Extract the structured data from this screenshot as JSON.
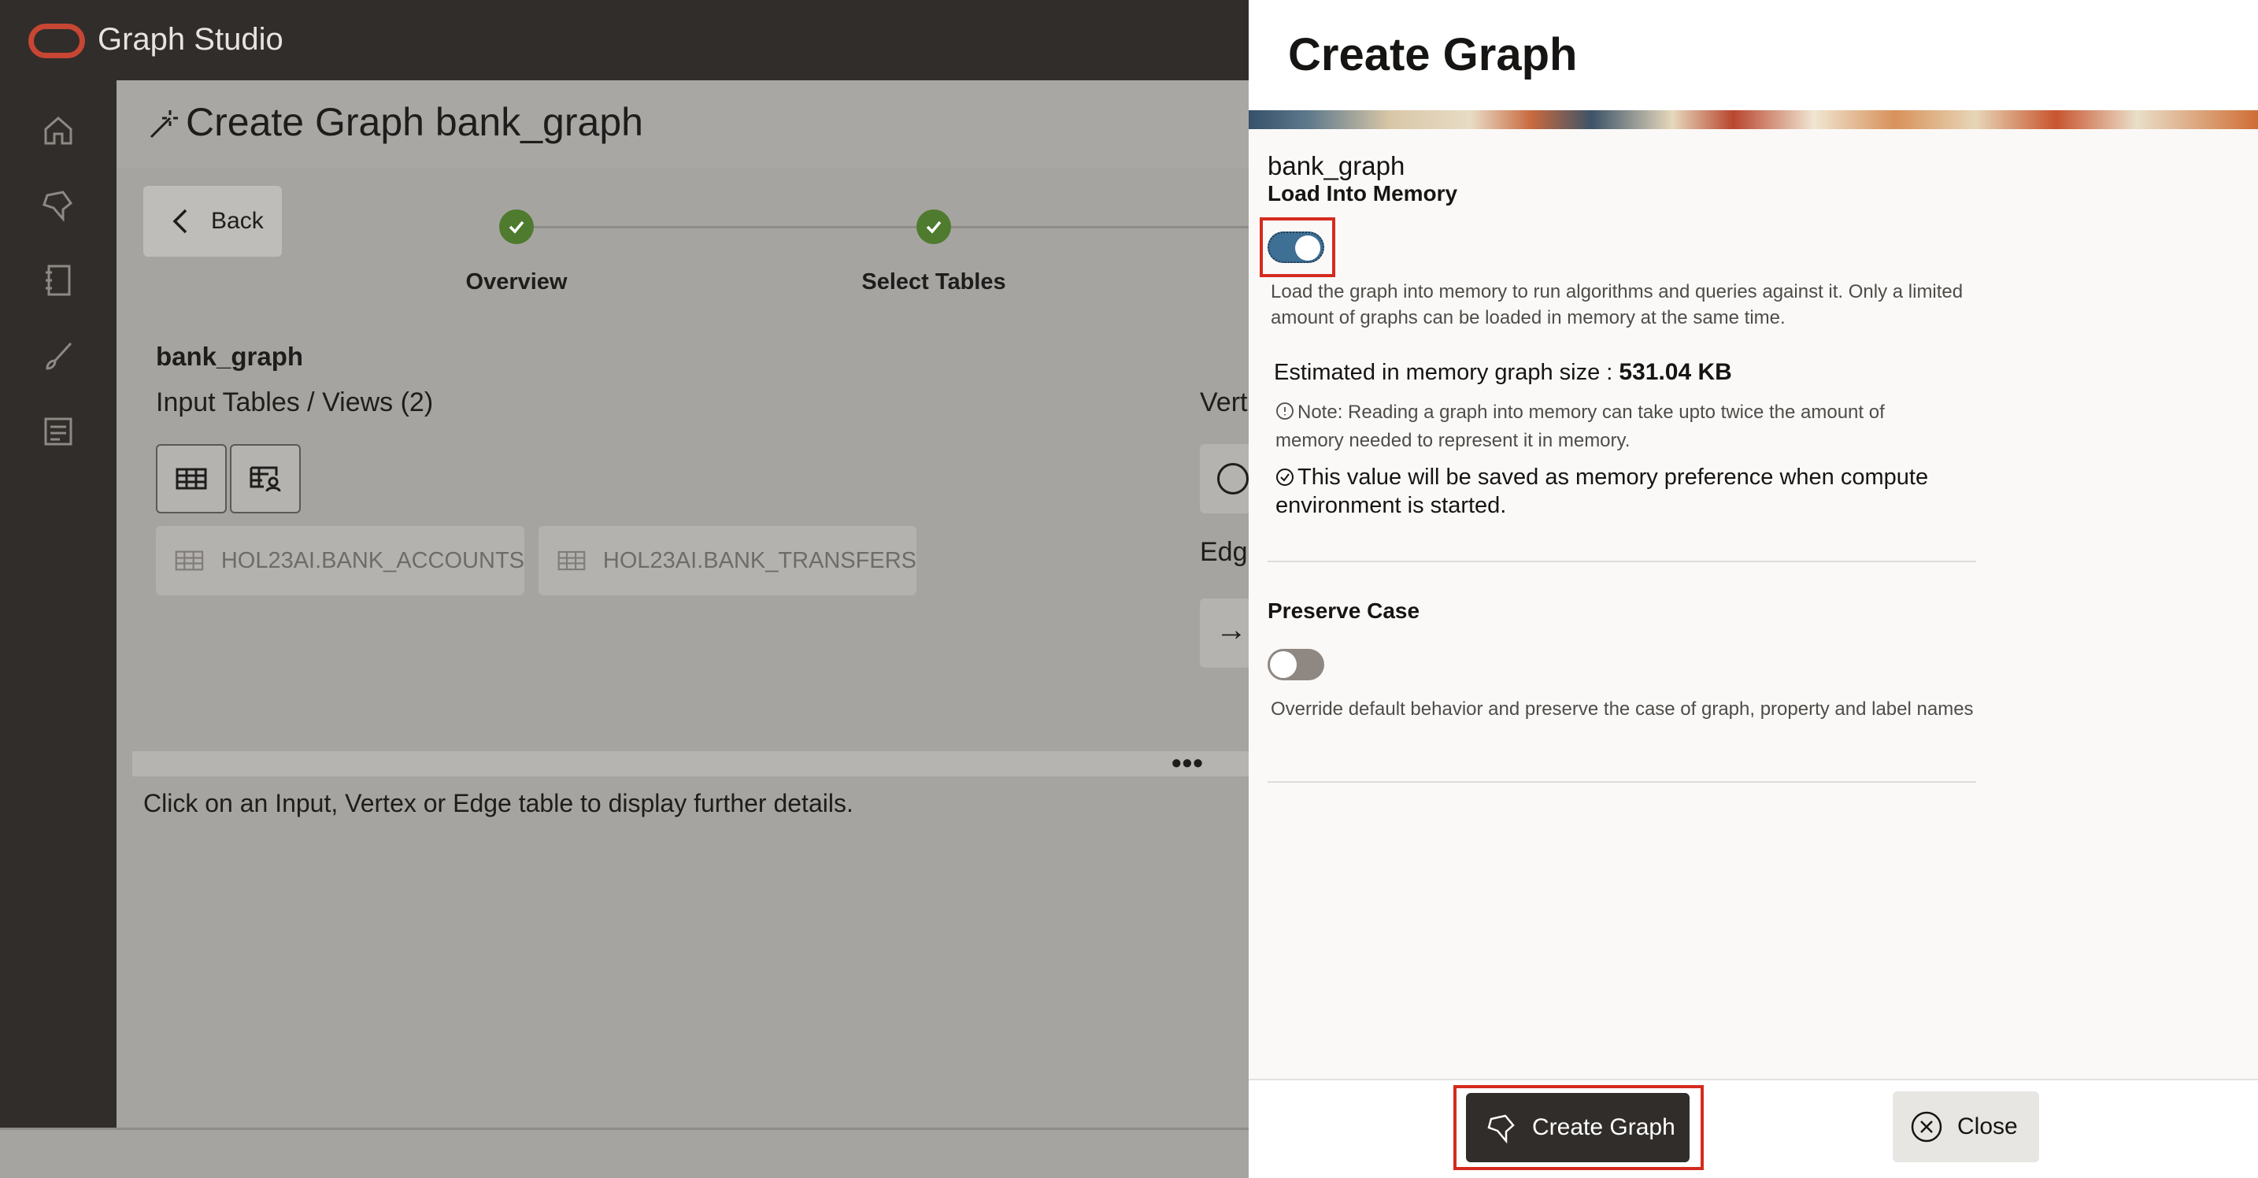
{
  "app": {
    "title": "Graph Studio"
  },
  "sidebar": {
    "items": [
      {
        "icon": "home-icon"
      },
      {
        "icon": "graph-icon"
      },
      {
        "icon": "notebook-icon"
      },
      {
        "icon": "brush-icon"
      },
      {
        "icon": "jobs-icon"
      }
    ],
    "expand_label": ">>"
  },
  "page": {
    "title": "Create Graph bank_graph",
    "back_label": "Back",
    "steps": [
      {
        "label": "Overview",
        "state": "done"
      },
      {
        "label": "Select Tables",
        "state": "done"
      }
    ],
    "graph_name": "bank_graph",
    "input_tables_label": "Input Tables / Views (2)",
    "vertex_label_partial": "Vert",
    "edge_label_partial": "Edge",
    "input_tables": [
      {
        "name": "HOL23AI.BANK_ACCOUNTS"
      },
      {
        "name": "HOL23AI.BANK_TRANSFERS"
      }
    ],
    "more_dots": "•••",
    "hint": "Click on an Input, Vertex or Edge table to display further details."
  },
  "drawer": {
    "title": "Create Graph",
    "graph_name": "bank_graph",
    "load_into_memory": {
      "label": "Load Into Memory",
      "enabled": true,
      "description": "Load the graph into memory to run algorithms and queries against it. Only a limited amount of graphs can be loaded in memory at the same time."
    },
    "estimate": {
      "label": "Estimated in memory graph size : ",
      "value": "531.04 KB"
    },
    "note": "Note: Reading a graph into memory can take upto twice the amount of memory needed to represent it in memory.",
    "saved_info": "This value will be saved as memory preference when compute environment is started.",
    "preserve_case": {
      "label": "Preserve Case",
      "enabled": false,
      "description": "Override default behavior and preserve the case of graph, property and label names"
    },
    "buttons": {
      "create_label": "Create Graph",
      "close_label": "Close"
    }
  },
  "colors": {
    "accent_toggle": "#3e6f94",
    "highlight": "#d42b1e",
    "step_done": "#4e7b2d",
    "brand_logo": "#c74634"
  }
}
